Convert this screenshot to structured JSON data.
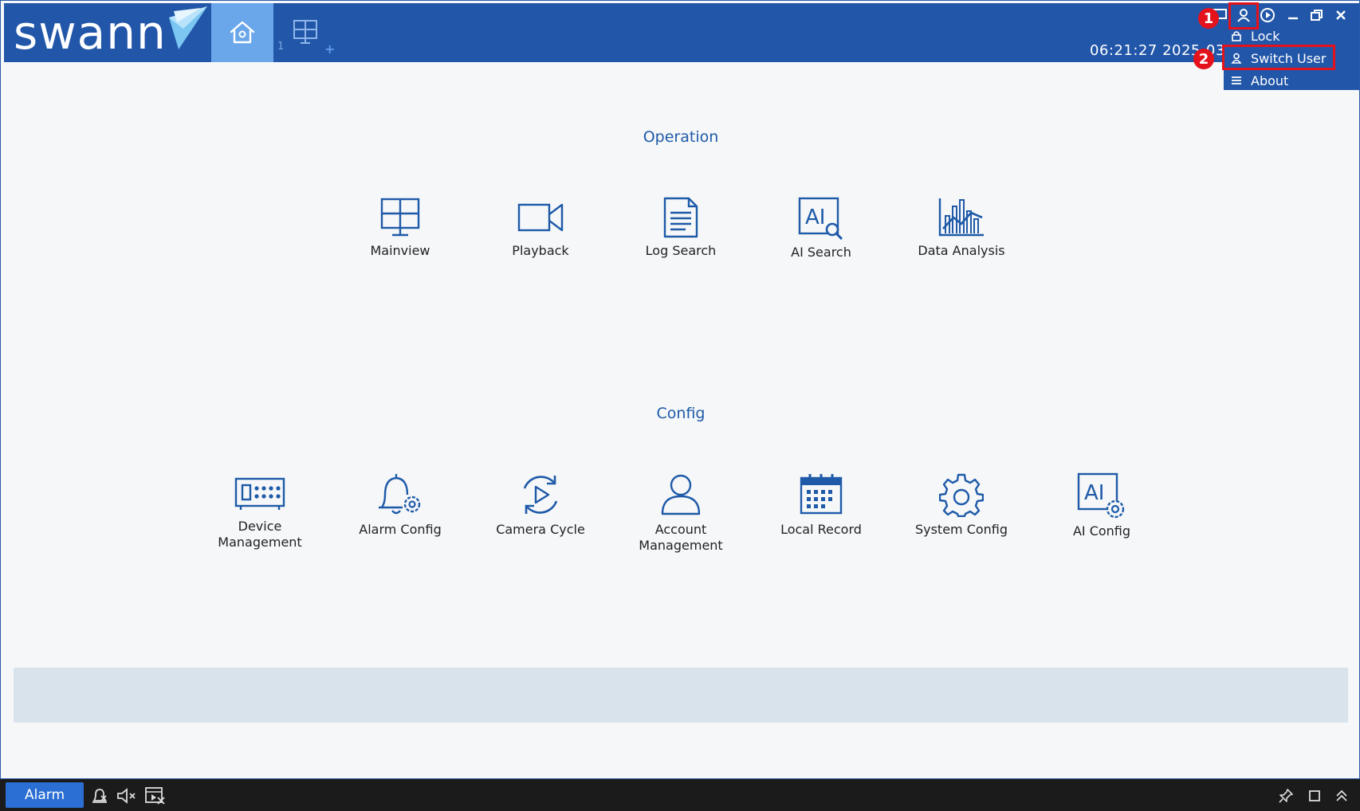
{
  "header": {
    "logo_text": "swann",
    "home_tab_icon": "home-icon",
    "view_tab_icon": "grid-view-icon",
    "view_tab_number": "1",
    "add_tab_symbol": "+",
    "clock": "06:21:27 2025-03"
  },
  "window_controls": [
    "monitor-icon",
    "user-icon",
    "playback-icon",
    "minimize-icon",
    "restore-icon",
    "close-icon"
  ],
  "annotations": {
    "marker_1": "1",
    "marker_2": "2"
  },
  "user_menu": {
    "items": [
      {
        "label": "Lock",
        "icon": "lock-icon"
      },
      {
        "label": "Switch User",
        "icon": "user-icon"
      },
      {
        "label": "About",
        "icon": "menu-lines-icon"
      }
    ]
  },
  "operation": {
    "title": "Operation",
    "items": [
      {
        "label": "Mainview",
        "icon": "mainview-icon"
      },
      {
        "label": "Playback",
        "icon": "video-camera-icon"
      },
      {
        "label": "Log Search",
        "icon": "document-icon"
      },
      {
        "label": "AI Search",
        "icon": "ai-search-icon"
      },
      {
        "label": "Data Analysis",
        "icon": "chart-icon"
      }
    ]
  },
  "config": {
    "title": "Config",
    "items": [
      {
        "label": "Device Management",
        "icon": "device-icon"
      },
      {
        "label": "Alarm Config",
        "icon": "bell-gear-icon"
      },
      {
        "label": "Camera Cycle",
        "icon": "cycle-play-icon"
      },
      {
        "label": "Account Management",
        "icon": "person-icon"
      },
      {
        "label": "Local Record",
        "icon": "calendar-icon"
      },
      {
        "label": "System Config",
        "icon": "gear-icon"
      },
      {
        "label": "AI Config",
        "icon": "ai-gear-icon"
      }
    ]
  },
  "taskbar": {
    "alarm_label": "Alarm",
    "icons": [
      "alarm-clear-icon",
      "mute-icon",
      "video-off-icon",
      "pin-icon",
      "window-icon",
      "expand-up-icon"
    ]
  },
  "colors": {
    "header_bg": "#2256a9",
    "active_tab": "#6aa7ea",
    "accent": "#1e5aa8",
    "highlight": "#e4121b",
    "taskbar_bg": "#1b1b1b",
    "alarm_button": "#2b6fd4"
  }
}
